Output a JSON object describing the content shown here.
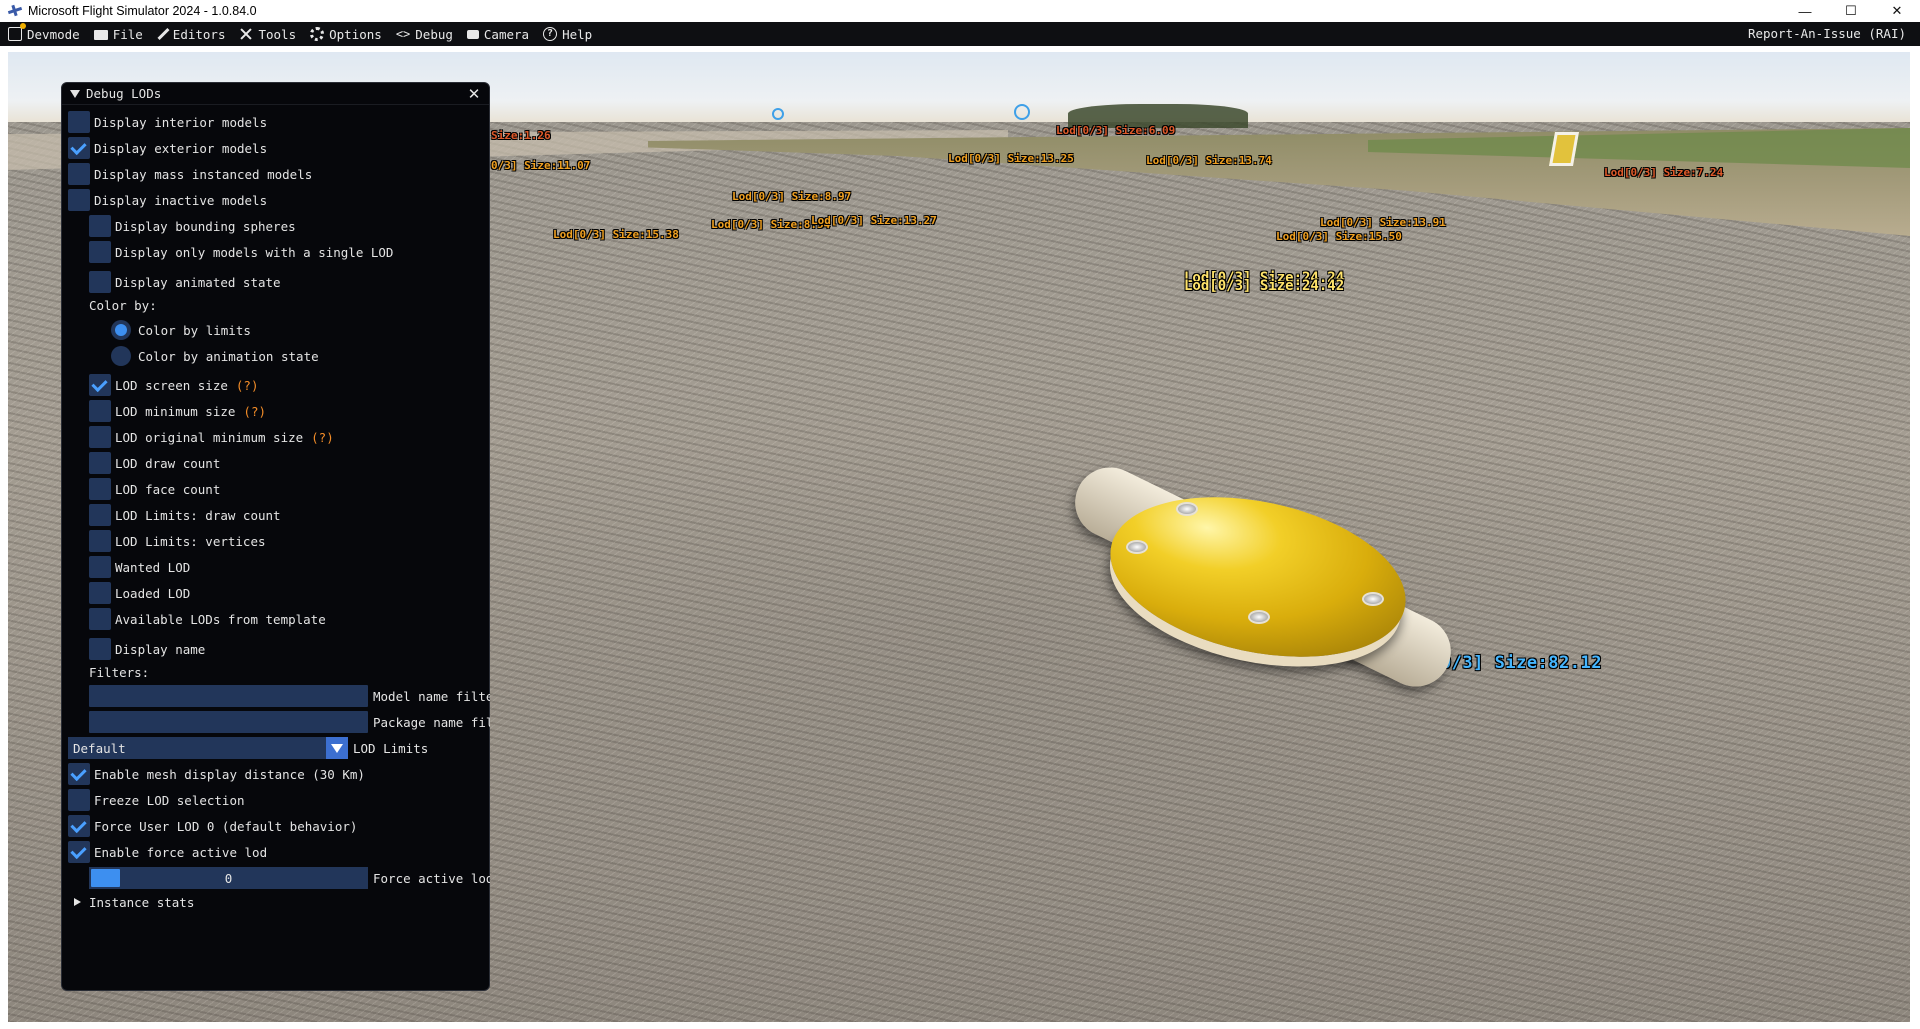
{
  "window": {
    "title": "Microsoft Flight Simulator 2024 - 1.0.84.0",
    "controls": [
      "—",
      "☐",
      "✕"
    ]
  },
  "devbar": {
    "items": [
      {
        "label": "Devmode",
        "icon": "devmode-icon"
      },
      {
        "label": "File",
        "icon": "folder-icon"
      },
      {
        "label": "Editors",
        "icon": "pencil-icon"
      },
      {
        "label": "Tools",
        "icon": "tools-icon"
      },
      {
        "label": "Options",
        "icon": "gear-icon"
      },
      {
        "label": "Debug",
        "icon": "code-icon"
      },
      {
        "label": "Camera",
        "icon": "camera-icon"
      },
      {
        "label": "Help",
        "icon": "help-icon"
      }
    ],
    "rai": "Report-An-Issue (RAI)"
  },
  "scene": {
    "labels": [
      "Size:1.26",
      "Lod[0/3] Size:6.09",
      "0/3] Size:11.07",
      "Lod[0/3] Size:13.25",
      "Lod[0/3] Size:13.74",
      "Lod[0/3] Size:7.24",
      "Lod[0/3] Size:8.97",
      "Lod[0/3] Size:8.54",
      "Lod[0/3] Size:13.27",
      "Lod[0/3] Size:13.91",
      "Lod[0/3] Size:15.38",
      "Lod[0/3] Size:15.50",
      "Lod[0/3] Size:24.24",
      "Lod[0/3] Size:24.42",
      "Lod[0/3] Size:82.12"
    ]
  },
  "panel": {
    "title": "Debug LODs",
    "close": "✕",
    "display_interior": "Display interior models",
    "display_exterior": "Display exterior models",
    "display_mass": "Display mass instanced models",
    "display_inactive": "Display inactive models",
    "display_bounding": "Display bounding spheres",
    "display_single_lod": "Display only models with a single LOD",
    "display_animated": "Display animated state",
    "color_by": "Color by:",
    "color_limits": "Color by limits",
    "color_animation": "Color by animation state",
    "lod_screen_size": "LOD screen size",
    "lod_min_size": "LOD minimum size",
    "lod_orig_min_size": "LOD original minimum size",
    "help_marker": "(?)",
    "lod_draw_count": "LOD draw count",
    "lod_face_count": "LOD face count",
    "lod_limits_draw": "LOD Limits: draw count",
    "lod_limits_vertices": "LOD Limits: vertices",
    "wanted_lod": "Wanted LOD",
    "loaded_lod": "Loaded LOD",
    "available_lods": "Available LODs from template",
    "display_name": "Display name",
    "filters": "Filters:",
    "model_filter_label": "Model name filte",
    "package_filter_label": "Package name fil",
    "lod_limits_value": "Default",
    "lod_limits_label": "LOD Limits",
    "enable_mesh_distance": "Enable mesh display distance (30 Km)",
    "freeze_lod": "Freeze LOD selection",
    "force_user_lod": "Force User LOD 0 (default behavior)",
    "enable_force_active": "Enable force active lod",
    "force_active_value": "0",
    "force_active_label": "Force active lod",
    "instance_stats": "Instance stats"
  }
}
